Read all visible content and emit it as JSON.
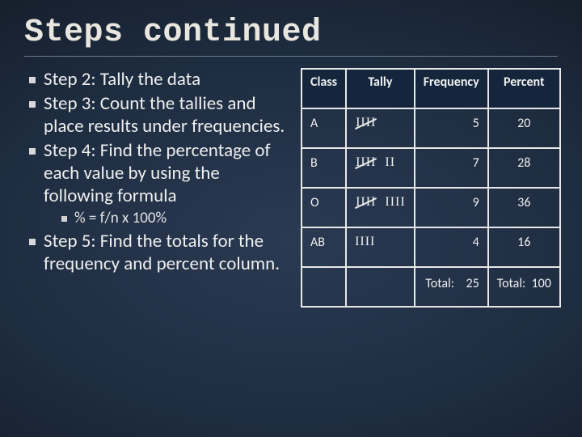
{
  "title": "Steps continued",
  "steps": {
    "s2": "Step 2: Tally the data",
    "s3": "Step 3: Count the tallies and place results under frequencies.",
    "s4": "Step 4: Find the percentage of each value by using the following formula",
    "s4_sub": "% = f/n x 100%",
    "s5": "Step 5: Find the totals for the frequency and percent column."
  },
  "chart_data": {
    "type": "table",
    "columns": [
      "Class",
      "Tally",
      "Frequency",
      "Percent"
    ],
    "rows": [
      {
        "class": "A",
        "tally_groups": [
          5
        ],
        "frequency": 5,
        "percent": 20
      },
      {
        "class": "B",
        "tally_groups": [
          5,
          2
        ],
        "frequency": 7,
        "percent": 28
      },
      {
        "class": "O",
        "tally_groups": [
          5,
          4
        ],
        "frequency": 9,
        "percent": 36
      },
      {
        "class": "AB",
        "tally_groups": [
          4
        ],
        "frequency": 4,
        "percent": 16
      }
    ],
    "totals": {
      "freq_label": "Total:",
      "freq_value": 25,
      "pct_label": "Total:",
      "pct_value": 100
    }
  }
}
